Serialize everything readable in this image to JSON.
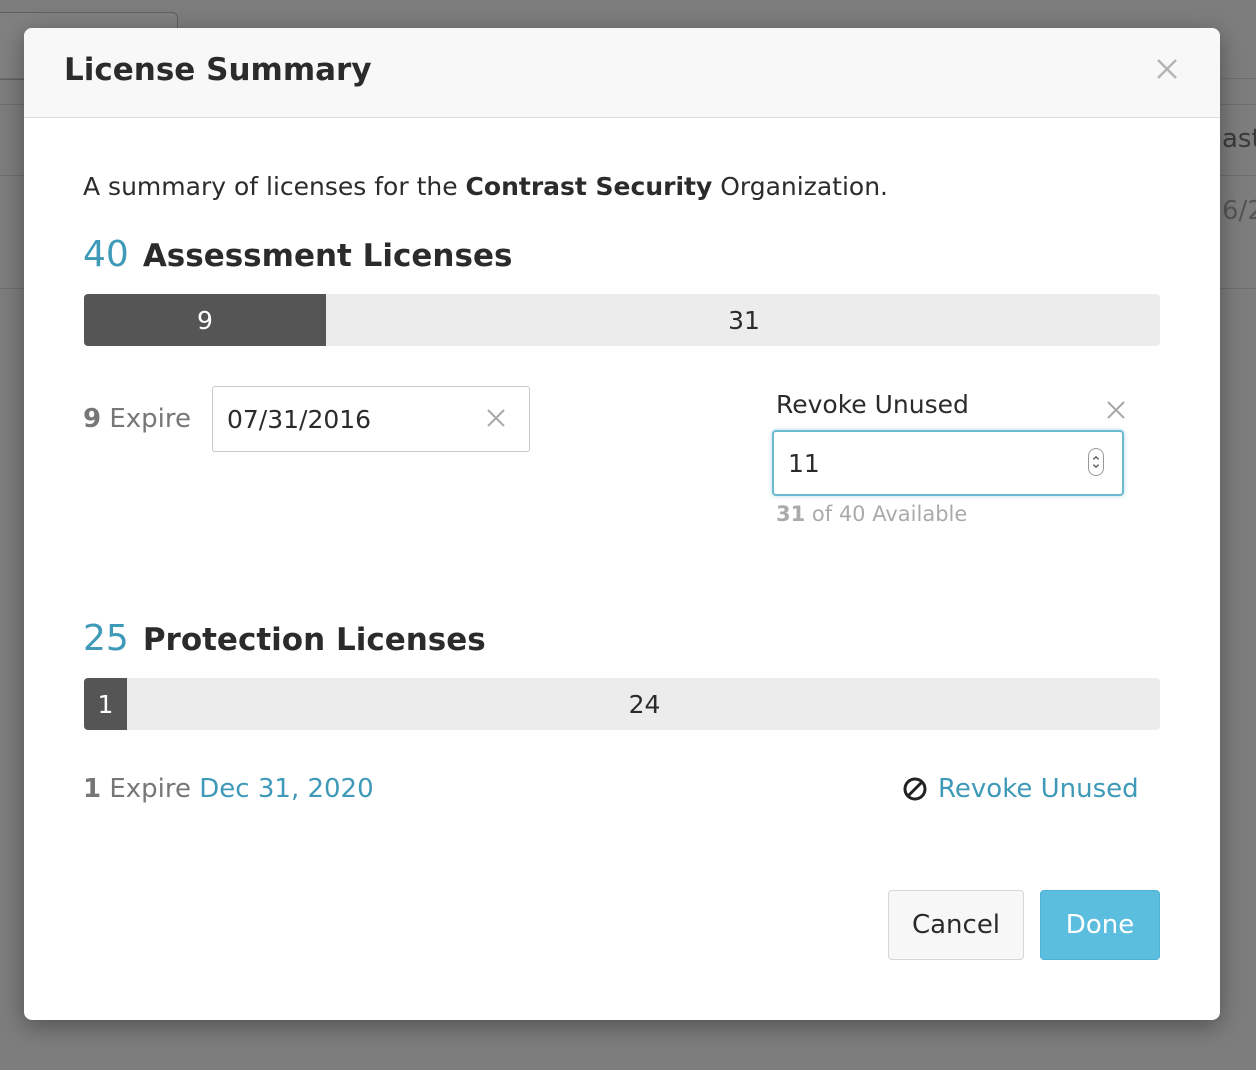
{
  "background": {
    "fragment_top": "ast",
    "fragment_bottom": "6/2"
  },
  "modal": {
    "title": "License Summary",
    "summary_prefix": "A summary of licenses for the ",
    "summary_org": "Contrast Security",
    "summary_suffix": " Organization."
  },
  "assessment": {
    "total": "40",
    "label": "Assessment Licenses",
    "used": 9,
    "available": 31,
    "used_label": "9",
    "available_label": "31",
    "expire_count": "9",
    "expire_word": " Expire",
    "expire_date": "07/31/2016",
    "revoke_label": "Revoke Unused",
    "revoke_value": "11",
    "avail_count": "31",
    "avail_suffix": " of 40 Available"
  },
  "protection": {
    "total": "25",
    "label": "Protection Licenses",
    "used": 1,
    "available": 24,
    "used_label": "1",
    "available_label": "24",
    "expire_count": "1",
    "expire_word": " Expire ",
    "expire_date": "Dec 31, 2020",
    "revoke_link": "Revoke Unused"
  },
  "buttons": {
    "cancel": "Cancel",
    "done": "Done"
  },
  "colors": {
    "accent": "#3e9ab8",
    "primary_button": "#5bbedf",
    "used_bar": "#555555",
    "available_bar": "#ececec"
  }
}
